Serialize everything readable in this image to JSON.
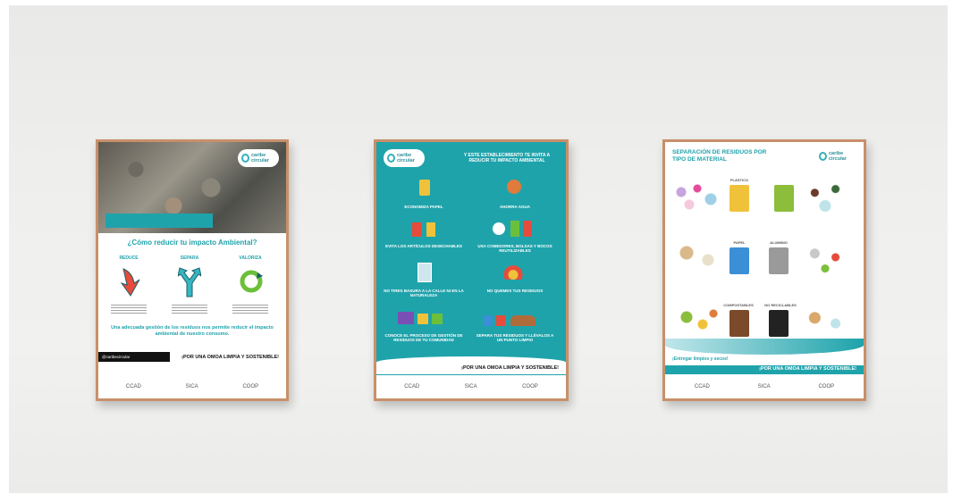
{
  "posters": [
    {
      "logo": "caribe circular",
      "heading": "¿Cómo reducir tu impacto Ambiental?",
      "columns": [
        {
          "label": "REDUCE",
          "icon": "down-arrow-icon"
        },
        {
          "label": "SEPARA",
          "icon": "split-arrow-icon"
        },
        {
          "label": "VALORIZA",
          "icon": "recycle-icon"
        }
      ],
      "body": "Una adecuada gestión de los residuos nos permite reducir el impacto ambiental de nuestro consumo.",
      "social": "@caribecircular",
      "slogan": "¡POR UNA OMOA LIMPIA Y SOSTENIBLE!",
      "footer_logos": [
        "CCAD",
        "SICA",
        "COOP"
      ]
    },
    {
      "logo": "caribe circular",
      "heading": "Y ESTE ESTABLECIMIENTO TE INVITA A REDUCIR TU IMPACTO AMBIENTAL",
      "items": [
        "ECONOMIZA PAPEL",
        "AHORRA AGUA",
        "EVITA LOS ARTÍCULOS DESECHABLES",
        "USA COMEDORES, BOLSAS Y BOCOS REUTILIZABLES",
        "NO TIRES BASURA A LA CALLE NI EN LA NATURALEZA",
        "NO QUEMES TUS RESIDUOS",
        "CONOCE EL PROCESO DE GESTIÓN DE RESIDUOS DE TU COMUNIDAD",
        "SEPARA TUS RESIDUOS Y LLÉVALOS A UN PUNTO LIMPIO"
      ],
      "slogan": "¡POR UNA OMOA LIMPIA Y SOSTENIBLE!",
      "footer_logos": [
        "CCAD",
        "SICA",
        "COOP"
      ]
    },
    {
      "logo": "caribe circular",
      "heading": "SEPARACIÓN DE RESIDUOS POR TIPO DE MATERIAL",
      "bins": [
        {
          "label": "PLÁSTICO",
          "color": "#f0c23a"
        },
        {
          "label": "",
          "color": "#8cbd3b"
        },
        {
          "label": "PAPEL",
          "color": "#3a8fd6"
        },
        {
          "label": "ALUMINIO",
          "color": "#9a9a9a"
        },
        {
          "label": "COMPOSTABLES",
          "color": "#7a4a2a"
        },
        {
          "label": "NO RECICLABLES",
          "color": "#222222"
        }
      ],
      "tagline": "¡Entregar limpios y secos!",
      "slogan": "¡POR UNA OMOA LIMPIA Y SOSTENIBLE!",
      "footer_logos": [
        "CCAD",
        "SICA",
        "COOP"
      ]
    }
  ],
  "colors": {
    "teal": "#1fa3ab",
    "frame": "#c8906a",
    "wall": "#eeeeec"
  }
}
